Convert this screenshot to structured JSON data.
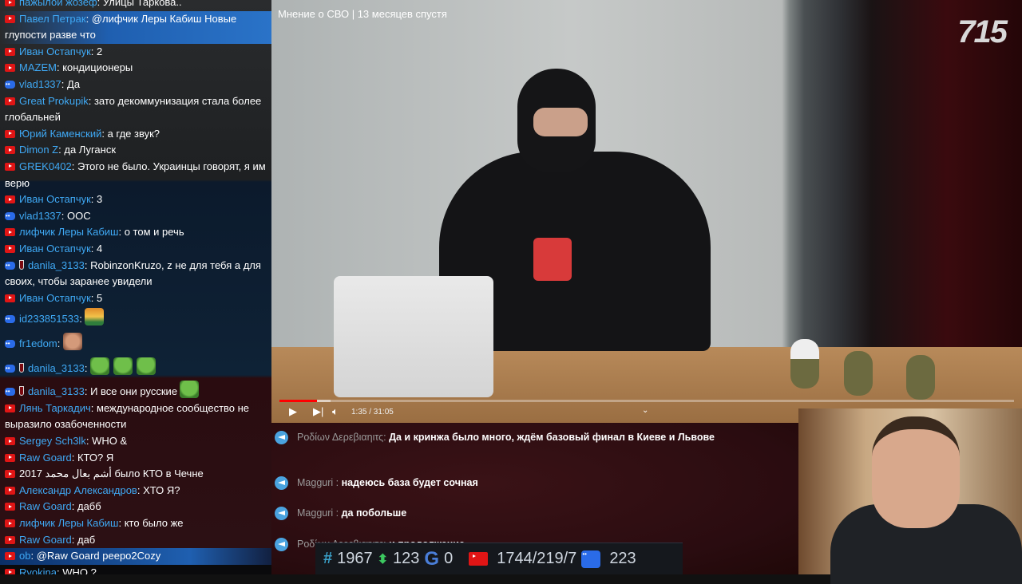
{
  "chat": [
    {
      "p": "yt",
      "name": "пажылой жозеф",
      "text": "Улицы Таркова.."
    },
    {
      "p": "yt",
      "name": "Павел Петрак",
      "text": "@лифчик Леры Кабиш Новые глупости разве что",
      "hl": true
    },
    {
      "p": "yt",
      "name": "Иван Остапчук",
      "text": "2"
    },
    {
      "p": "yt",
      "name": "MAZEM",
      "text": "кондиционеры"
    },
    {
      "p": "vk",
      "name": "vlad1337",
      "text": "Да"
    },
    {
      "p": "yt",
      "name": "Great Prokupik",
      "text": "зато декоммунизация стала более глобальней"
    },
    {
      "p": "yt",
      "name": "Юрий Каменский",
      "text": "а где звук?"
    },
    {
      "p": "yt",
      "name": "Dimon Z",
      "text": "да Луганск"
    },
    {
      "p": "yt",
      "name": "GREK0402",
      "text": "Этого не было. Украинцы говорят, я им верю"
    },
    {
      "p": "yt",
      "name": "Иван Остапчук",
      "text": "3"
    },
    {
      "p": "vk",
      "name": "vlad1337",
      "text": "ООС"
    },
    {
      "p": "yt",
      "name": "лифчик Леры Кабиш",
      "text": "о том и речь"
    },
    {
      "p": "yt",
      "name": "Иван Остапчук",
      "text": "4"
    },
    {
      "p": "vk",
      "badge": true,
      "name": "danila_3133",
      "text": "RobinzonKruzo, z не для тебя а для своих, чтобы заранее увидели"
    },
    {
      "p": "yt",
      "name": "Иван Остапчук",
      "text": "5"
    },
    {
      "p": "vk",
      "name": "id233851533",
      "text": "",
      "emotes": [
        "sun"
      ]
    },
    {
      "p": "vk",
      "name": "fr1edom",
      "text": "",
      "emotes": [
        "man"
      ]
    },
    {
      "p": "vk",
      "badge": true,
      "name": "danila_3133",
      "text": "",
      "emotes": [
        "pepe",
        "pepe",
        "pepe"
      ]
    },
    {
      "p": "vk",
      "badge": true,
      "name": "danila_3133",
      "text": "И все они русские",
      "emotes_after": [
        "pepe"
      ]
    },
    {
      "p": "yt",
      "name": "Лянь Таркадич",
      "text": "международное сообщество не выразило озабоченности"
    },
    {
      "p": "yt",
      "name": "Sergey Sch3lk",
      "text": "WHO &"
    },
    {
      "p": "yt",
      "name": "Raw Goard",
      "text": "КТО? Я"
    },
    {
      "p": "yt",
      "name": "2017 أشم بعال محمد",
      "text": "было КТО в Чечне",
      "plainname": true
    },
    {
      "p": "yt",
      "name": "Александр Александров",
      "text": "ХТО Я?"
    },
    {
      "p": "yt",
      "name": "Raw Goard",
      "text": "дабб"
    },
    {
      "p": "yt",
      "name": "лифчик Леры Кабиш",
      "text": "кто было же"
    },
    {
      "p": "yt",
      "name": "Raw Goard",
      "text": "даб"
    },
    {
      "p": "yt",
      "name": "ob",
      "text": "@Raw Goard peepo2Cozy",
      "hlb": true
    },
    {
      "p": "yt",
      "name": "Ryokina",
      "text": "WHO ?"
    }
  ],
  "video": {
    "title": "Мнение о СВО | 13 месяцев спустя",
    "channel_logo": "715",
    "time": "1:35 / 31:05",
    "progress": 0.051,
    "buffered": 0.07
  },
  "telegram": [
    {
      "name": "Ροδίων Δερεβιαηιτς:",
      "text": "Да и кринжа было много, ждём базовый финал в Киеве и Львове"
    },
    {
      "name": "Magguri :",
      "text": "надеюсь база будет сочная"
    },
    {
      "name": "Magguri :",
      "text": "да побольше"
    },
    {
      "name": "Ροδίων Δερεβιαηιτς:",
      "text": "и продолжение"
    }
  ],
  "stats": {
    "hash": "1967",
    "updown": "123",
    "g": "0",
    "youtube": "1744/219/7",
    "vk": "223"
  },
  "colors": {
    "chat_name": "#3fa9f5",
    "youtube": "#e01515",
    "vk": "#2a6be8",
    "telegram": "#4aa3df",
    "progress": "#ff0000"
  }
}
